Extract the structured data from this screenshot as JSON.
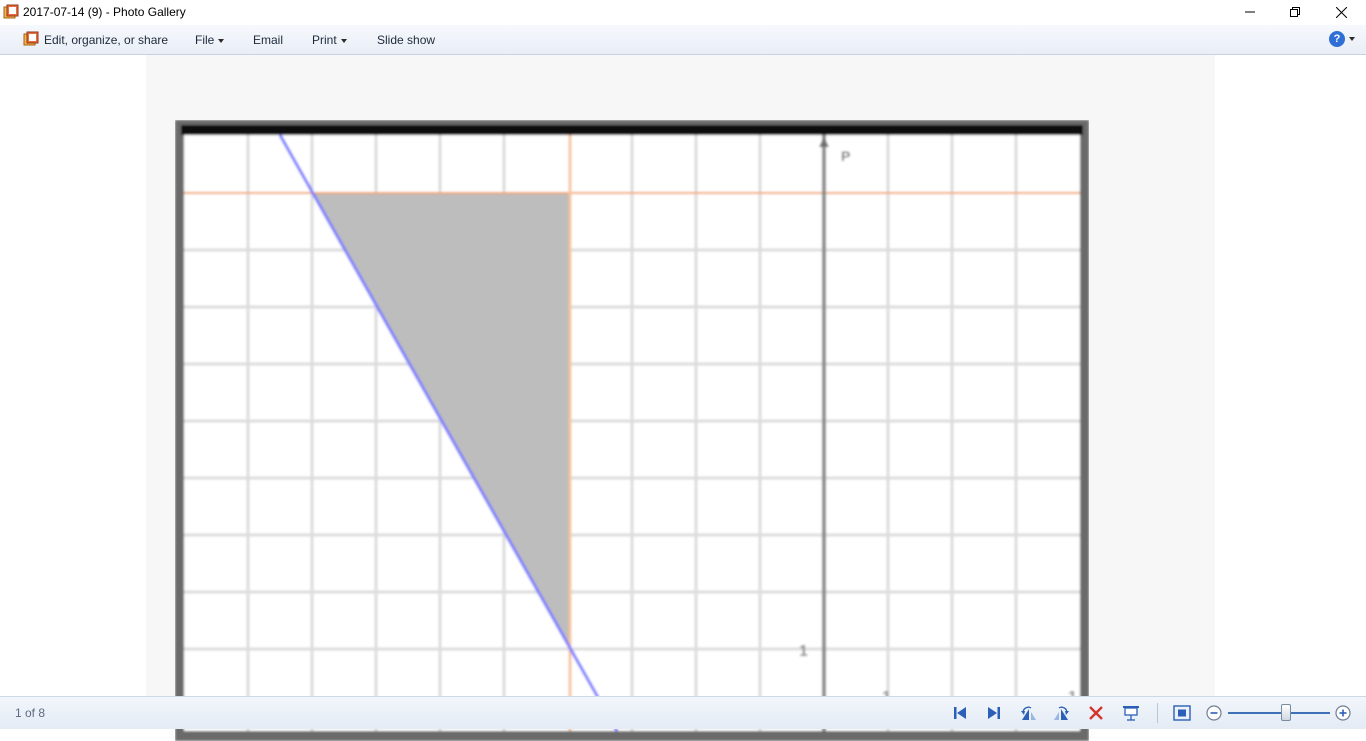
{
  "window": {
    "title": "2017-07-14 (9) - Photo Gallery"
  },
  "commandbar": {
    "edit_label": "Edit, organize, or share",
    "file_label": "File",
    "email_label": "Email",
    "print_label": "Print",
    "slideshow_label": "Slide show",
    "help_label": "?"
  },
  "statusbar": {
    "page_counter": "1 of 8"
  },
  "photo": {
    "point_labels": [
      "P",
      "1",
      "1",
      "1"
    ]
  },
  "colors": {
    "accent": "#2f6fd6",
    "shade_fill": "#bdbdbd",
    "line_blue": "#7b7bff",
    "line_orange": "#f2a46a",
    "delete_red": "#d6342c"
  },
  "icons": {
    "app": "photo-gallery-icon",
    "minimize": "minimize-icon",
    "maximize": "restore-icon",
    "close": "close-icon",
    "prev": "previous-icon",
    "next": "next-icon",
    "rotate_left": "rotate-left-icon",
    "rotate_right": "rotate-right-icon",
    "delete": "delete-icon",
    "slideshow": "slideshow-icon",
    "fit": "fit-to-window-icon",
    "zoom_out": "zoom-out-icon",
    "zoom_in": "zoom-in-icon",
    "help": "help-icon"
  }
}
